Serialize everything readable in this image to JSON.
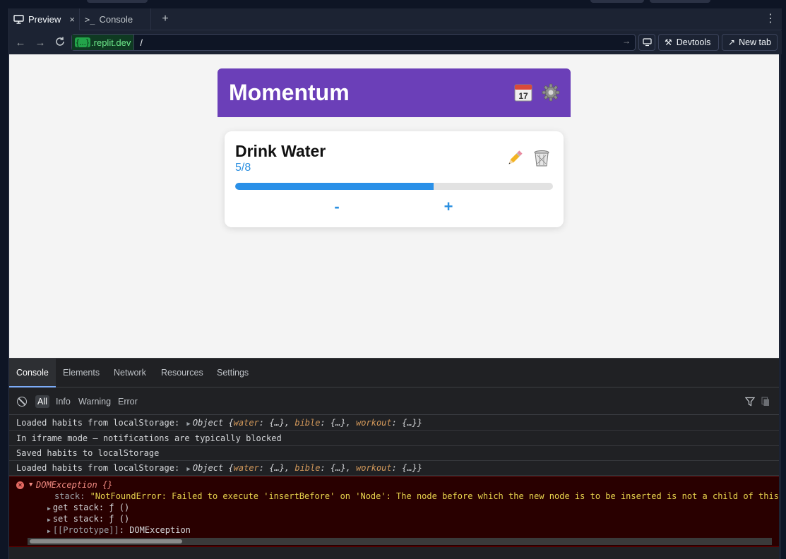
{
  "tabs": {
    "preview_label": "Preview",
    "console_label": "Console",
    "close_glyph": "×",
    "add_glyph": "+",
    "menu_glyph": "⋮"
  },
  "urlbar": {
    "host_badge": "{...}",
    "host_suffix": ".replit.dev",
    "path": "/",
    "devtools_label": "Devtools",
    "newtab_label": "New tab"
  },
  "app": {
    "title": "Momentum",
    "habit": {
      "name": "Drink Water",
      "count_text": "5/8",
      "progress_fraction": 0.625,
      "minus_label": "-",
      "plus_label": "+"
    },
    "colors": {
      "header": "#6b3fb8",
      "accent": "#2a90e8"
    }
  },
  "devtools": {
    "tabs": [
      "Console",
      "Elements",
      "Network",
      "Resources",
      "Settings"
    ],
    "filters": [
      "All",
      "Info",
      "Warning",
      "Error"
    ],
    "logs": [
      {
        "prefix": "Loaded habits from localStorage: ",
        "object": true
      },
      {
        "text": "In iframe mode – notifications are typically blocked"
      },
      {
        "text": "Saved habits to localStorage"
      },
      {
        "prefix": "Loaded habits from localStorage: ",
        "object": true
      }
    ],
    "object_label": "Object",
    "object_keys": [
      "water",
      "bible",
      "workout"
    ],
    "error": {
      "title": "DOMException {}",
      "stack_key": "stack",
      "stack_value": "\"NotFoundError: Failed to execute 'insertBefore' on 'Node': The node before which the new node is to be inserted is not a child of this",
      "get_stack": "get stack: ƒ ()",
      "set_stack": "set stack: ƒ ()",
      "proto_key": "[[Prototype]]",
      "proto_value": ": DOMException"
    }
  }
}
